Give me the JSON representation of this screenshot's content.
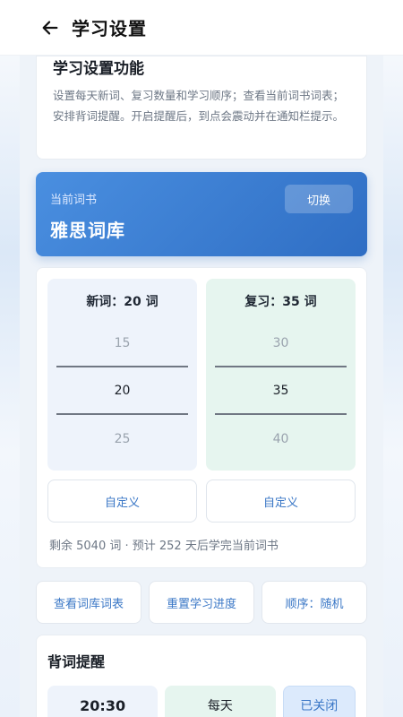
{
  "header": {
    "title": "学习设置",
    "back_icon": "arrow-left-icon"
  },
  "intro": {
    "title": "学习设置功能",
    "description": "设置每天新词、复习数量和学习顺序；查看当前词书词表；安排背词提醒。开启提醒后，到点会震动并在通知栏提示。"
  },
  "book": {
    "label": "当前词书",
    "name": "雅思词库",
    "switch_label": "切换"
  },
  "plan": {
    "new_picker": {
      "title": "新词：20 词",
      "above": "15",
      "selected": "20",
      "below": "25"
    },
    "review_picker": {
      "title": "复习：35 词",
      "above": "30",
      "selected": "35",
      "below": "40"
    },
    "custom_new_label": "自定义",
    "custom_review_label": "自定义",
    "remaining_text": "剩余 5040 词 · 预计 252 天后学完当前词书"
  },
  "actions": {
    "view_list": "查看词库词表",
    "reset_progress": "重置学习进度",
    "order": "顺序：随机"
  },
  "reminder": {
    "title": "背词提醒",
    "time": "20:30",
    "frequency": "每天",
    "status": "已关闭"
  },
  "colors": {
    "accent": "#3a77c6",
    "book_gradient_start": "#4a8fe0",
    "book_gradient_end": "#2f6ec4",
    "new_bg": "#eef3fb",
    "review_bg": "#e6f5ef"
  }
}
